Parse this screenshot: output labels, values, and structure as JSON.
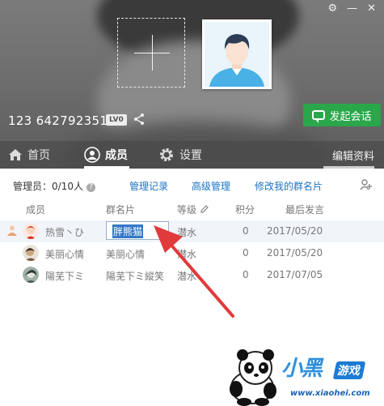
{
  "colors": {
    "link": "#1c73c4",
    "chat_button": "#2aa74a",
    "selection": "#3278c8",
    "arrow": "#e03a3a"
  },
  "group": {
    "id_text": "123 642792351",
    "level_badge": "LV0"
  },
  "header": {
    "chat_button_label": "发起会话"
  },
  "tabs": [
    {
      "label": "首页",
      "icon": "home-icon"
    },
    {
      "label": "成员",
      "icon": "person-icon",
      "active": true
    },
    {
      "label": "设置",
      "icon": "gear-icon"
    }
  ],
  "edit_profile_label": "编辑资料",
  "toolbar": {
    "admins": "管理员：0/10人",
    "links": [
      "管理记录",
      "高级管理",
      "修改我的群名片"
    ]
  },
  "table": {
    "columns": [
      "成员",
      "群名片",
      "等级",
      "积分",
      "最后发言"
    ],
    "rows": [
      {
        "name": "热雪丶ひ",
        "card": "胖熊猫",
        "level": "潜水",
        "points": "0",
        "last": "2017/05/20",
        "editing": true
      },
      {
        "name": "美丽心情",
        "card": "美丽心情",
        "level": "潜水",
        "points": "0",
        "last": "2017/05/20"
      },
      {
        "name": "陽芜下ミ",
        "card": "陽芜下ミ縱笑",
        "level": "潜水",
        "points": "0",
        "last": "2017/07/05"
      }
    ]
  },
  "watermark": {
    "brand": "小黑",
    "game": "游戏",
    "url": "www.xiaohei.com"
  }
}
